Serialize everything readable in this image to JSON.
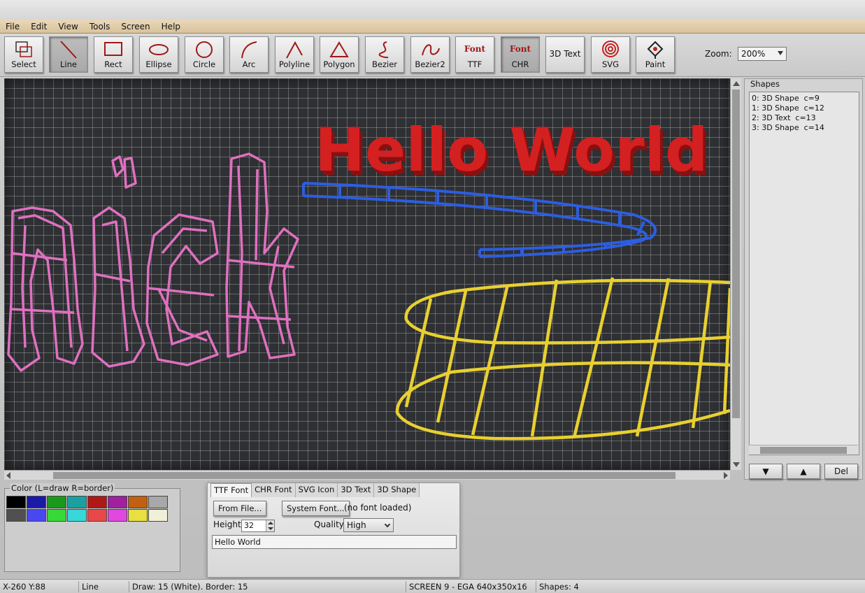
{
  "menu": [
    "File",
    "Edit",
    "View",
    "Tools",
    "Screen",
    "Help"
  ],
  "toolbar": {
    "tools": [
      {
        "label": "Select",
        "icon": "select-icon"
      },
      {
        "label": "Line",
        "icon": "line-icon",
        "active": true
      },
      {
        "label": "Rect",
        "icon": "rect-icon"
      },
      {
        "label": "Ellipse",
        "icon": "ellipse-icon"
      },
      {
        "label": "Circle",
        "icon": "circle-icon"
      },
      {
        "label": "Arc",
        "icon": "arc-icon"
      },
      {
        "label": "Polyline",
        "icon": "polyline-icon"
      },
      {
        "label": "Polygon",
        "icon": "polygon-icon"
      },
      {
        "label": "Bezier",
        "icon": "bezier-icon"
      },
      {
        "label": "Bezier2",
        "icon": "bezier2-icon"
      },
      {
        "label": "TTF",
        "caption": "Font",
        "icon": "font-ttf-icon"
      },
      {
        "label": "CHR",
        "caption": "Font",
        "icon": "font-chr-icon",
        "active": true
      },
      {
        "label": "",
        "caption": "3D Text",
        "icon": "3d-text-icon"
      },
      {
        "label": "SVG",
        "icon": "svg-icon"
      },
      {
        "label": "Paint",
        "icon": "paint-icon"
      }
    ],
    "zoom_label": "Zoom:",
    "zoom_value": "200%"
  },
  "canvas": {
    "text_shape": "Hello World",
    "colors": {
      "pink": "#e070c0",
      "blue": "#2d5ee0",
      "yellow": "#e8d030",
      "red": "#d02020"
    }
  },
  "shapes_panel": {
    "title": "Shapes",
    "items": [
      "0: 3D Shape  c=9",
      "1: 3D Shape  c=12",
      "2: 3D Text  c=13",
      "3: 3D Shape  c=14"
    ],
    "down_label": "▼",
    "up_label": "▲",
    "del_label": "Del"
  },
  "color_panel": {
    "title": "Color (L=draw R=border)",
    "swatches": [
      "#000000",
      "#1a1aa8",
      "#1a9a1a",
      "#1aa0a0",
      "#b01818",
      "#a020a0",
      "#c06010",
      "#a8a8a8",
      "#505050",
      "#4848f0",
      "#38d838",
      "#38d8d8",
      "#e84848",
      "#e048e0",
      "#e8e040",
      "#f0f0d8"
    ]
  },
  "font_panel": {
    "tabs": [
      "TTF Font",
      "CHR Font",
      "SVG Icon",
      "3D Text",
      "3D Shape"
    ],
    "from_file": "From File...",
    "system_font": "System Font...",
    "no_font": "(no font loaded)",
    "height_label": "Height",
    "height_value": "32",
    "quality_label": "Quality",
    "quality_value": "High",
    "text_value": "Hello World"
  },
  "status": {
    "coords": "X-260 Y:88",
    "tool": "Line",
    "draw": "Draw: 15 (White). Border: 15",
    "screen": "SCREEN 9 - EGA 640x350x16",
    "shapes": "Shapes: 4"
  }
}
